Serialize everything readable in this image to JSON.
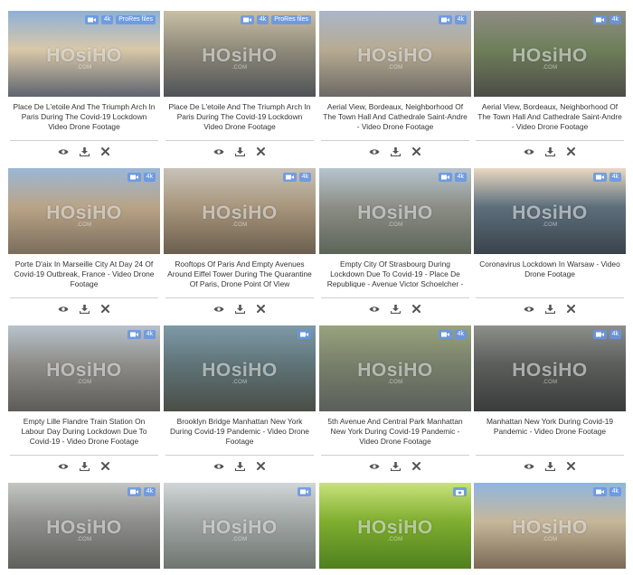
{
  "watermark": "HOsiHO",
  "watermark_sub": ".COM",
  "badge_labels": {
    "k4": "4k",
    "prores": "ProRes files"
  },
  "icons": {
    "view": "eye-icon",
    "download": "download-icon",
    "remove": "close-icon",
    "video": "video-camera-icon",
    "photo": "camera-icon"
  },
  "cards": [
    {
      "title": "Place De L'etoile And The Triumph Arch In Paris During The Covid-19 Lockdown Video Drone Footage",
      "badges": [
        "video",
        "k4",
        "prores"
      ],
      "colors": [
        "#8fb0d8",
        "#d8c8a8",
        "#5f6470"
      ],
      "has_caption": true
    },
    {
      "title": "Place De L'etoile And The Triumph Arch In Paris During The Covid-19 Lockdown Video Drone Footage",
      "badges": [
        "video",
        "k4",
        "prores"
      ],
      "colors": [
        "#c9bfa6",
        "#8f8a7a",
        "#4f5257"
      ],
      "has_caption": true
    },
    {
      "title": "Aerial View, Bordeaux, Neighborhood Of The Town Hall And Cathedrale Saint-Andre - Video Drone Footage",
      "badges": [
        "video",
        "k4"
      ],
      "colors": [
        "#a9b6c9",
        "#b7ab93",
        "#6d6a64"
      ],
      "has_caption": true
    },
    {
      "title": "Aerial View, Bordeaux, Neighborhood Of The Town Hall And Cathedrale Saint-Andre - Video Drone Footage",
      "badges": [
        "video",
        "k4"
      ],
      "colors": [
        "#8f8c83",
        "#6e7f5a",
        "#4d4c48"
      ],
      "has_caption": true
    },
    {
      "title": "Porte D'aix In Marseille City At Day 24 Of Covid-19 Outbreak, France - Video Drone Footage",
      "badges": [
        "video",
        "k4"
      ],
      "colors": [
        "#9bb8d6",
        "#b9a487",
        "#7b6d5c"
      ],
      "has_caption": true
    },
    {
      "title": "Rooftops Of Paris And Empty Avenues Around Eiffel Tower During The Quarantine Of Paris, Drone Point Of View",
      "badges": [
        "video",
        "k4"
      ],
      "colors": [
        "#c7c2b8",
        "#a8967c",
        "#6b5e4f"
      ],
      "has_caption": true
    },
    {
      "title": "Empty City Of Strasbourg During Lockdown Due To Covid-19 - Place De Republique - Avenue Victor Schoelcher -",
      "badges": [
        "video",
        "k4"
      ],
      "colors": [
        "#b7c4cf",
        "#8c8e86",
        "#5c6458"
      ],
      "has_caption": true
    },
    {
      "title": "Coronavirus Lockdown In Warsaw - Video Drone Footage",
      "badges": [
        "video",
        "k4"
      ],
      "colors": [
        "#e9d9c2",
        "#5d6f7c",
        "#39434b"
      ],
      "has_caption": true
    },
    {
      "title": "Empty Lille Flandre Train Station On Labour Day During Lockdown Due To Covid-19 - Video Drone Footage",
      "badges": [
        "video",
        "k4"
      ],
      "colors": [
        "#b9c3cc",
        "#8e8c88",
        "#5d5b58"
      ],
      "has_caption": true
    },
    {
      "title": "Brooklyn Bridge Manhattan New York During Covid-19 Pandemic - Video Drone Footage",
      "badges": [
        "video"
      ],
      "colors": [
        "#7e9aa8",
        "#5f7478",
        "#4a4d45"
      ],
      "has_caption": true
    },
    {
      "title": "5th Avenue And Central Park Manhattan New York During Covid-19 Pandemic - Video Drone Footage",
      "badges": [
        "video",
        "k4"
      ],
      "colors": [
        "#9aa37e",
        "#77806a",
        "#5a5f5b"
      ],
      "has_caption": true
    },
    {
      "title": "Manhattan New York During Covid-19 Pandemic - Video Drone Footage",
      "badges": [
        "video",
        "k4"
      ],
      "colors": [
        "#8d8f8a",
        "#5c5e5c",
        "#3a3c3c"
      ],
      "has_caption": true
    },
    {
      "title": "",
      "badges": [
        "video",
        "k4"
      ],
      "colors": [
        "#c4c6c4",
        "#8e8f8c",
        "#5f5f5c"
      ],
      "has_caption": false
    },
    {
      "title": "",
      "badges": [
        "video"
      ],
      "colors": [
        "#d1d6d8",
        "#9fa5a3",
        "#6f7570"
      ],
      "has_caption": false
    },
    {
      "title": "",
      "badges": [
        "photo"
      ],
      "colors": [
        "#c9e27a",
        "#7fae2f",
        "#4f7f1f"
      ],
      "has_caption": false
    },
    {
      "title": "",
      "badges": [
        "video",
        "k4"
      ],
      "colors": [
        "#8fb6e0",
        "#c7b79a",
        "#7a6a56"
      ],
      "has_caption": false
    }
  ]
}
